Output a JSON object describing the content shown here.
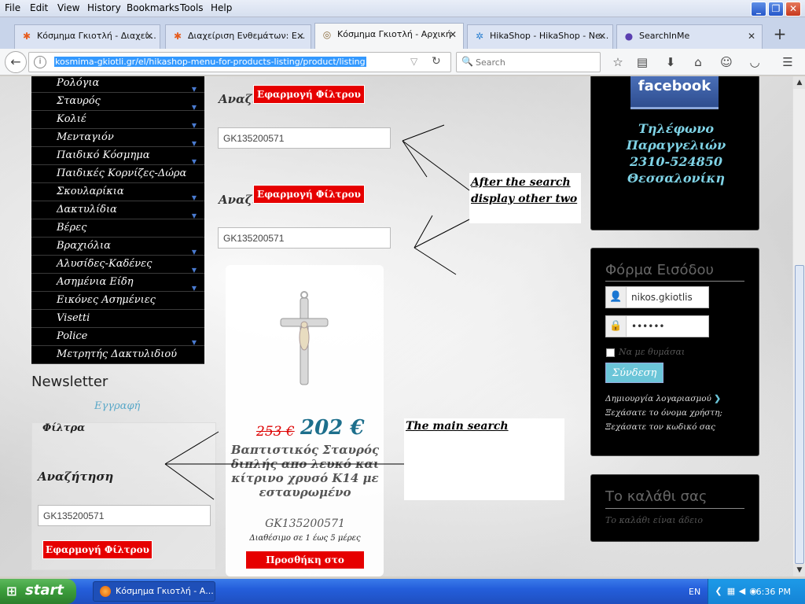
{
  "menubar": {
    "items": [
      "File",
      "Edit",
      "View",
      "History",
      "Bookmarks",
      "Tools",
      "Help"
    ]
  },
  "tabs": [
    {
      "label": "Κόσμημα Γκιοτλή - Διαχεί...",
      "icon": "joomla-icon",
      "active": false
    },
    {
      "label": "Διαχείριση Ενθεμάτων: Ε...",
      "icon": "joomla-icon",
      "active": false
    },
    {
      "label": "Κόσμημα Γκιοτλή - Αρχική",
      "icon": "site-icon",
      "active": true
    },
    {
      "label": "HikaShop - HikaShop - Ne...",
      "icon": "hikashop-icon",
      "active": false
    },
    {
      "label": "SearchInMe",
      "icon": "searchinme-icon",
      "active": false
    }
  ],
  "nav": {
    "url": "kosmima-gkiotli.gr/el/hikashop-menu-for-products-listing/product/listing",
    "search_placeholder": "Search"
  },
  "categories": [
    {
      "label": "Ρολόγια",
      "has_sub": true
    },
    {
      "label": "Σταυρός",
      "has_sub": true
    },
    {
      "label": "Κολιέ",
      "has_sub": true
    },
    {
      "label": "Μενταγιόν",
      "has_sub": true
    },
    {
      "label": "Παιδικό Κόσμημα",
      "has_sub": true
    },
    {
      "label": "Παιδικές Κορνίζες-Δώρα",
      "has_sub": false
    },
    {
      "label": "Σκουλαρίκια",
      "has_sub": true
    },
    {
      "label": "Δακτυλίδια",
      "has_sub": true
    },
    {
      "label": "Βέρες",
      "has_sub": false
    },
    {
      "label": "Βραχιόλια",
      "has_sub": true
    },
    {
      "label": "Αλυσίδες-Καδένες",
      "has_sub": true
    },
    {
      "label": "Ασημένια Είδη",
      "has_sub": true
    },
    {
      "label": "Εικόνες Ασημένιες",
      "has_sub": false
    },
    {
      "label": "Visetti",
      "has_sub": false
    },
    {
      "label": "Police",
      "has_sub": true
    },
    {
      "label": "Μετρητής Δακτυλιδιού",
      "has_sub": false
    }
  ],
  "newsletter": {
    "title": "Newsletter",
    "subscribe": "Εγγραφή"
  },
  "filters": {
    "title": "Φίλτρα",
    "search_label": "Αναζήτηση",
    "search_value": "GK135200571",
    "apply_label": "Εφαρμογή Φίλτρου"
  },
  "middle_filters": [
    {
      "label": "Αναζ...",
      "value": "GK135200571",
      "apply_label": "Εφαρμογή Φίλτρου"
    },
    {
      "label": "Αναζ...",
      "value": "GK135200571",
      "apply_label": "Εφαρμογή Φίλτρου"
    }
  ],
  "product": {
    "old_price": "253 €",
    "new_price": "202 €",
    "name": "Βαπτιστικός Σταυρός διπλής απο λευκό και κίτρινο χρυσό Κ14 με εσταυρωμένο",
    "code": "GK135200571",
    "availability": "Διαθέσιμο σε 1 έως 5 μέρες",
    "add_to_cart": "Προσθήκη στο καλάθι"
  },
  "annotations": {
    "top": "After the search display other two",
    "main": "The main search"
  },
  "right": {
    "facebook": "facebook",
    "phone_lines": [
      "Τηλέφωνο",
      "Παραγγελιών",
      "2310-524850",
      "Θεσσαλονίκη"
    ],
    "login_title": "Φόρμα Εισόδου",
    "username": "nikos.gkiotlis",
    "password": "••••••",
    "remember": "Να με θυμάσαι",
    "login_button": "Σύνδεση",
    "create_account": "Δημιουργία λογαριασμού",
    "forgot_username": "Ξεχάσατε το όνομα χρήστη;",
    "forgot_password": "Ξεχάσατε τον κωδικό σας",
    "cart_title": "Το καλάθι σας",
    "cart_empty": "Το καλάθι είναι άδειο"
  },
  "taskbar": {
    "start": "start",
    "window": "Κόσμημα Γκιοτλή - Α...",
    "lang": "EN",
    "time": "6:36 PM"
  },
  "colors": {
    "accent_red": "#e60000",
    "price_blue": "#1d6f8c",
    "phone_cyan": "#7fd3e6",
    "login_button": "#6bc5d8"
  }
}
